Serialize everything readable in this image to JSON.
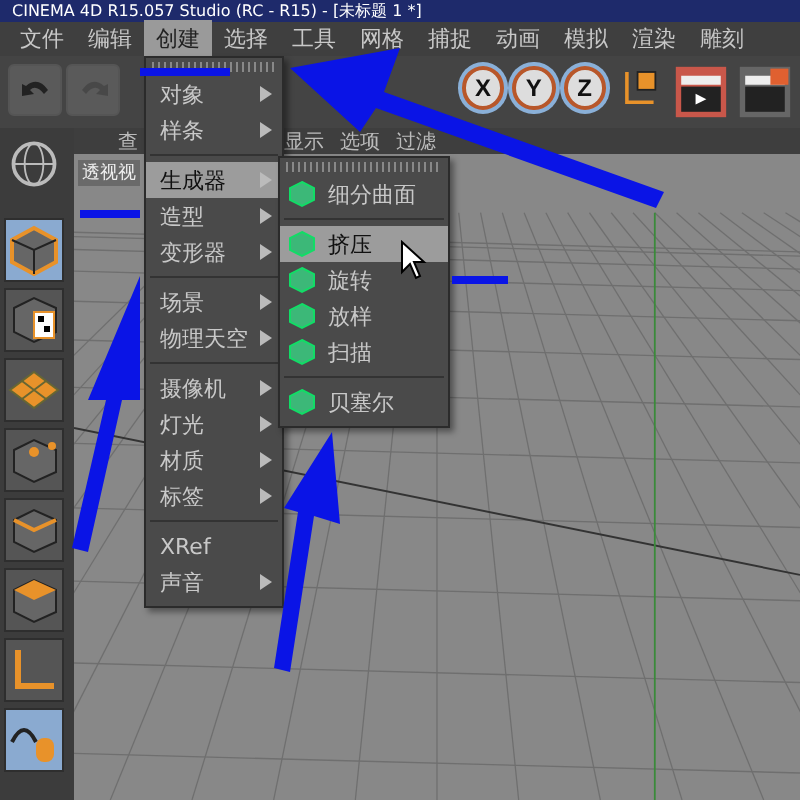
{
  "window": {
    "title": "CINEMA 4D R15.057 Studio (RC - R15) - [未标题 1 *]"
  },
  "menu_bar": [
    {
      "label": "文件",
      "selected": false
    },
    {
      "label": "编辑",
      "selected": false
    },
    {
      "label": "创建",
      "selected": true
    },
    {
      "label": "选择",
      "selected": false
    },
    {
      "label": "工具",
      "selected": false
    },
    {
      "label": "网格",
      "selected": false
    },
    {
      "label": "捕捉",
      "selected": false
    },
    {
      "label": "动画",
      "selected": false
    },
    {
      "label": "模拟",
      "selected": false
    },
    {
      "label": "渲染",
      "selected": false
    },
    {
      "label": "雕刻",
      "selected": false
    }
  ],
  "toolbar": {
    "undo_disabled": false,
    "redo_disabled": true,
    "axis_buttons": [
      {
        "label": "X",
        "selected": true
      },
      {
        "label": "Y",
        "selected": true
      },
      {
        "label": "Z",
        "selected": true
      }
    ]
  },
  "left_palette": [
    {
      "kind": "cube",
      "selected": true
    },
    {
      "kind": "texture",
      "selected": false
    },
    {
      "kind": "grid",
      "selected": false
    },
    {
      "kind": "points",
      "selected": false
    },
    {
      "kind": "edges",
      "selected": false
    },
    {
      "kind": "polygons",
      "selected": false
    },
    {
      "kind": "axis",
      "selected": false
    },
    {
      "kind": "sculpt",
      "selected": true
    }
  ],
  "viewport": {
    "tabs": [
      "查",
      "显示",
      "选项",
      "过滤"
    ],
    "label": "透视视"
  },
  "create_menu": [
    {
      "kind": "item",
      "label": "对象",
      "submenu": true,
      "selected": false
    },
    {
      "kind": "item",
      "label": "样条",
      "submenu": true,
      "selected": false
    },
    {
      "kind": "separator"
    },
    {
      "kind": "item",
      "label": "生成器",
      "submenu": true,
      "selected": true
    },
    {
      "kind": "item",
      "label": "造型",
      "submenu": true,
      "selected": false
    },
    {
      "kind": "item",
      "label": "变形器",
      "submenu": true,
      "selected": false
    },
    {
      "kind": "separator"
    },
    {
      "kind": "item",
      "label": "场景",
      "submenu": true,
      "selected": false
    },
    {
      "kind": "item",
      "label": "物理天空",
      "submenu": true,
      "selected": false
    },
    {
      "kind": "separator"
    },
    {
      "kind": "item",
      "label": "摄像机",
      "submenu": true,
      "selected": false
    },
    {
      "kind": "item",
      "label": "灯光",
      "submenu": true,
      "selected": false
    },
    {
      "kind": "item",
      "label": "材质",
      "submenu": true,
      "selected": false
    },
    {
      "kind": "item",
      "label": "标签",
      "submenu": true,
      "selected": false
    },
    {
      "kind": "separator"
    },
    {
      "kind": "item",
      "label": "XRef",
      "submenu": false,
      "selected": false
    },
    {
      "kind": "item",
      "label": "声音",
      "submenu": true,
      "selected": false
    }
  ],
  "generator_submenu": [
    {
      "kind": "item",
      "label": "细分曲面",
      "selected": false
    },
    {
      "kind": "separator"
    },
    {
      "kind": "item",
      "label": "挤压",
      "selected": true
    },
    {
      "kind": "item",
      "label": "旋转",
      "selected": false
    },
    {
      "kind": "item",
      "label": "放样",
      "selected": false
    },
    {
      "kind": "item",
      "label": "扫描",
      "selected": false
    },
    {
      "kind": "separator"
    },
    {
      "kind": "item",
      "label": "贝塞尔",
      "selected": false
    }
  ]
}
